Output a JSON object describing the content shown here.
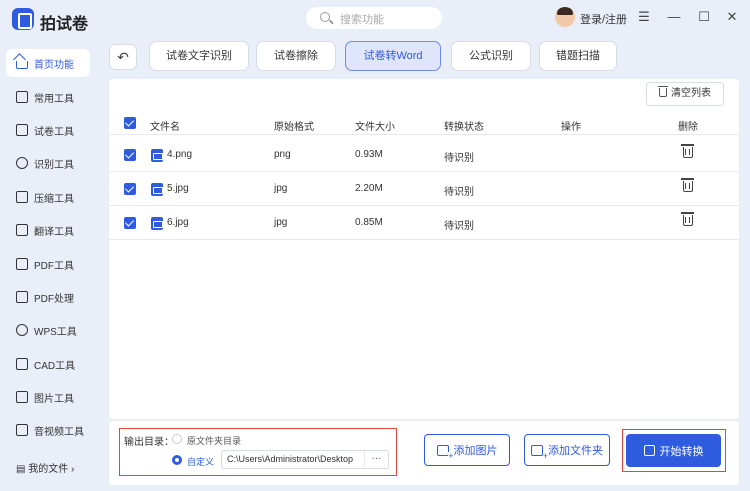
{
  "app": {
    "name": "拍试卷"
  },
  "search": {
    "placeholder": "搜索功能"
  },
  "account": {
    "login_label": "登录/注册"
  },
  "window_controls": [
    "menu",
    "minimize",
    "maximize",
    "close"
  ],
  "sidebar": {
    "items": [
      {
        "label": "首页功能",
        "icon": "home-icon",
        "active": true
      },
      {
        "label": "常用工具",
        "icon": "layers-icon"
      },
      {
        "label": "试卷工具",
        "icon": "document-icon"
      },
      {
        "label": "识别工具",
        "icon": "scan-icon"
      },
      {
        "label": "压缩工具",
        "icon": "compress-icon"
      },
      {
        "label": "翻译工具",
        "icon": "translate-icon"
      },
      {
        "label": "PDF工具",
        "icon": "pdf-icon"
      },
      {
        "label": "PDF处理",
        "icon": "pdf-process-icon"
      },
      {
        "label": "WPS工具",
        "icon": "wps-icon"
      },
      {
        "label": "CAD工具",
        "icon": "cad-icon"
      },
      {
        "label": "图片工具",
        "icon": "image-icon"
      },
      {
        "label": "音视频工具",
        "icon": "media-icon"
      }
    ],
    "my_files": "我的文件"
  },
  "tabs": [
    {
      "label": "试卷文字识别"
    },
    {
      "label": "试卷擦除"
    },
    {
      "label": "试卷转Word",
      "active": true
    },
    {
      "label": "公式识别"
    },
    {
      "label": "错题扫描"
    }
  ],
  "list": {
    "clear_label": "清空列表",
    "columns": [
      "文件名",
      "原始格式",
      "文件大小",
      "转换状态",
      "操作",
      "删除"
    ],
    "rows": [
      {
        "name": "4.png",
        "format": "png",
        "size": "0.93M",
        "status": "待识别",
        "checked": true
      },
      {
        "name": "5.jpg",
        "format": "jpg",
        "size": "2.20M",
        "status": "待识别",
        "checked": true
      },
      {
        "name": "6.jpg",
        "format": "jpg",
        "size": "0.85M",
        "status": "待识别",
        "checked": true
      }
    ]
  },
  "output": {
    "label": "输出目录：",
    "option_original": "原文件夹目录",
    "option_custom": "自定义",
    "selected": "custom",
    "path": "C:\\Users\\Administrator\\Desktop",
    "more": "···"
  },
  "actions": {
    "add_image": "添加图片",
    "add_folder": "添加文件夹",
    "start": "开始转换"
  },
  "colors": {
    "accent": "#2f5bdf",
    "highlight": "#e2473f",
    "background": "#e9eef8"
  }
}
